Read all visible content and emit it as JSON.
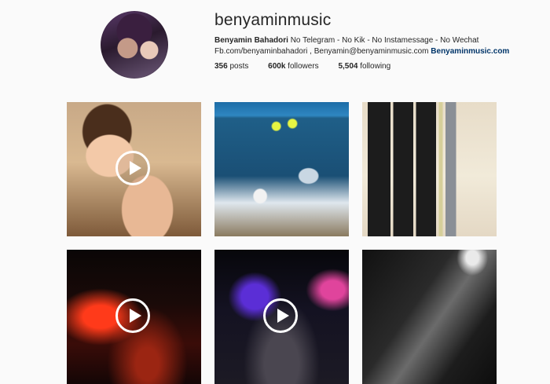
{
  "profile": {
    "username": "benyaminmusic",
    "full_name": "Benyamin Bahadori",
    "bio_line1": " No Telegram - No Kik - No Instamessage - No Wechat",
    "bio_line2": "Fb.com/benyaminbahadori , Benyamin@benyaminmusic.com ",
    "website": "Benyaminmusic.com",
    "avatar_icon": "profile-photo"
  },
  "stats": {
    "posts_count": "356",
    "posts_label": " posts",
    "followers_count": "600k",
    "followers_label": " followers",
    "following_count": "5,504",
    "following_label": " following"
  },
  "posts": [
    {
      "type": "video",
      "description_icon": "girl-photo"
    },
    {
      "type": "image",
      "description_icon": "beach-photo"
    },
    {
      "type": "image",
      "description_icon": "books-photo"
    },
    {
      "type": "video",
      "description_icon": "concert-photo"
    },
    {
      "type": "video",
      "description_icon": "concert-stage-photo"
    },
    {
      "type": "image",
      "description_icon": "audience-photo"
    }
  ],
  "colors": {
    "background": "#fafafa",
    "text": "#262626",
    "link": "#003569"
  }
}
